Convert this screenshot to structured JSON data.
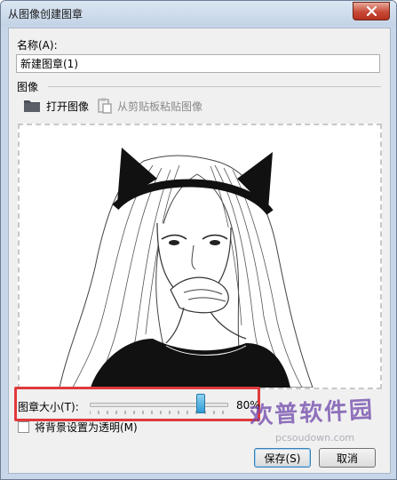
{
  "window": {
    "title": "从图像创建图章"
  },
  "name_field": {
    "label": "名称(A):",
    "value": "新建图章(1)"
  },
  "image_group": {
    "label": "图像"
  },
  "toolbar": {
    "open_label": "打开图像",
    "paste_label": "从剪贴板粘贴图像",
    "open_icon": "folder-icon",
    "paste_icon": "clipboard-paste-icon"
  },
  "stamp_size": {
    "label": "图章大小(T):",
    "value_text": "80%",
    "value": 0.8
  },
  "transparent_bg": {
    "label": "将背景设置为透明(M)",
    "checked": false
  },
  "buttons": {
    "save": "保存(S)",
    "cancel": "取消"
  },
  "watermark": {
    "text": "欢普软件园",
    "sub": "pcsoudown.com"
  },
  "colors": {
    "highlight": "#e03a3a",
    "close": "#c74a37",
    "slider_thumb": "#2f9bd3"
  }
}
